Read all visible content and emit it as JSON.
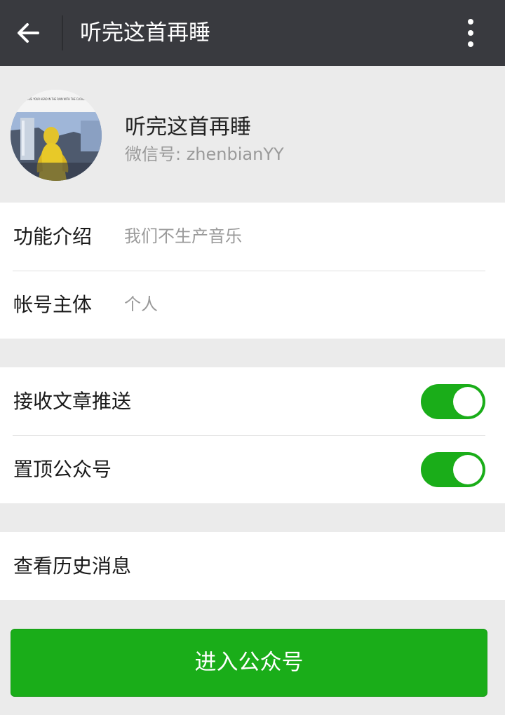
{
  "appbar": {
    "title": "听完这首再睡",
    "back_icon": "arrow-left-icon",
    "more_icon": "more-vertical-icon"
  },
  "profile": {
    "name": "听完这首再睡",
    "wechat_id": "微信号: zhenbianYY",
    "avatar_caption": "HAVE YOUR HEAD IN THE RAIN WITH THE CLOUDS"
  },
  "info": [
    {
      "label": "功能介绍",
      "value": "我们不生产音乐"
    },
    {
      "label": "帐号主体",
      "value": "个人"
    }
  ],
  "settings": [
    {
      "label": "接收文章推送",
      "on": true
    },
    {
      "label": "置顶公众号",
      "on": true
    }
  ],
  "history": {
    "label": "查看历史消息"
  },
  "enter_button": {
    "label": "进入公众号"
  },
  "colors": {
    "appbar": "#393a3f",
    "background": "#ebebeb",
    "accent_green": "#1aad19",
    "secondary_text": "#9a9a9a"
  }
}
